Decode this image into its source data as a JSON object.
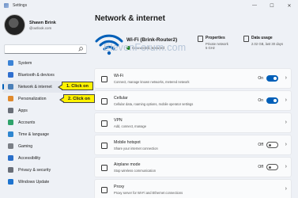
{
  "window": {
    "title": "Settings",
    "minimize": "—",
    "maximize": "☐",
    "close": "✕"
  },
  "profile": {
    "name": "Shawn Brink",
    "email": "@outlook.com"
  },
  "search": {
    "placeholder": ""
  },
  "sidebar": {
    "items": [
      {
        "label": "System",
        "icon": "monitor-icon",
        "color": "#3b83d6"
      },
      {
        "label": "Bluetooth & devices",
        "icon": "bluetooth-icon",
        "color": "#2f6fcf"
      },
      {
        "label": "Network & internet",
        "icon": "network-icon",
        "color": "#4a7fb8",
        "active": true
      },
      {
        "label": "Personalization",
        "icon": "brush-icon",
        "color": "#e08a2d"
      },
      {
        "label": "Apps",
        "icon": "apps-icon",
        "color": "#6a6f78"
      },
      {
        "label": "Accounts",
        "icon": "accounts-icon",
        "color": "#2fa36b"
      },
      {
        "label": "Time & language",
        "icon": "globe-clock-icon",
        "color": "#2f86d0"
      },
      {
        "label": "Gaming",
        "icon": "gamepad-icon",
        "color": "#7b7f86"
      },
      {
        "label": "Accessibility",
        "icon": "accessibility-icon",
        "color": "#2a6fc9"
      },
      {
        "label": "Privacy & security",
        "icon": "shield-icon",
        "color": "#6a6f78"
      },
      {
        "label": "Windows Update",
        "icon": "update-icon",
        "color": "#1e74cf"
      }
    ]
  },
  "main": {
    "title": "Network & internet",
    "hero": {
      "network": "Wi-Fi (Brink-Router2)",
      "status": "Connected, secured",
      "properties": {
        "title": "Properties",
        "line1": "Private network",
        "line2": "5 GHz"
      },
      "usage": {
        "title": "Data usage",
        "line1": "2.02 GB, last 30 days"
      }
    },
    "watermark": "ElevenForum.com",
    "rows": [
      {
        "title": "Wi-Fi",
        "desc": "Connect, manage known networks, metered network",
        "toggle": "On"
      },
      {
        "title": "Cellular",
        "desc": "Cellular data, roaming options, mobile operator settings",
        "toggle": "On"
      },
      {
        "title": "VPN",
        "desc": "Add, connect, manage",
        "toggle": ""
      },
      {
        "title": "Mobile hotspot",
        "desc": "Share your internet connection",
        "toggle": "Off"
      },
      {
        "title": "Airplane mode",
        "desc": "Stop wireless communication",
        "toggle": "Off"
      },
      {
        "title": "Proxy",
        "desc": "Proxy server for Wi-Fi and Ethernet connections",
        "toggle": ""
      }
    ],
    "chevron": "›"
  },
  "callouts": {
    "first": "1. Click on",
    "second": "2. Click on"
  },
  "colors": {
    "accent": "#005fb8",
    "callout": "#fff200"
  }
}
